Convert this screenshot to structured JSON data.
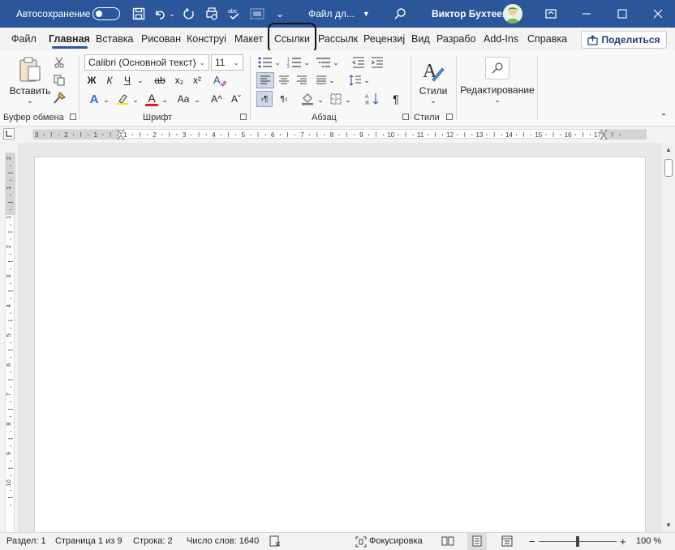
{
  "titlebar": {
    "autosave_label": "Автосохранение",
    "file_name": "Файл дл...",
    "user_name": "Виктор Бухтеев",
    "colors": {
      "bar": "#2b579a"
    }
  },
  "tabs": [
    {
      "label": "Файл"
    },
    {
      "label": "Главная"
    },
    {
      "label": "Вставка"
    },
    {
      "label": "Рисован"
    },
    {
      "label": "Конструі"
    },
    {
      "label": "Макет"
    },
    {
      "label": "Ссылки"
    },
    {
      "label": "Рассылк"
    },
    {
      "label": "Рецензиј"
    },
    {
      "label": "Вид"
    },
    {
      "label": "Разрабо"
    },
    {
      "label": "Add-Ins"
    },
    {
      "label": "Справка"
    }
  ],
  "share_label": "Поделиться",
  "ribbon": {
    "clipboard": {
      "paste_label": "Вставить",
      "group_label": "Буфер обмена"
    },
    "font": {
      "font_name": "Calibri (Основной текст)",
      "font_size": "11",
      "bold": "Ж",
      "italic": "К",
      "underline": "Ч",
      "strike": "ab",
      "sub": "x₂",
      "sup": "x²",
      "text_effects": "A",
      "highlight": "ab",
      "font_color": "A",
      "change_case": "Aa",
      "grow": "A^",
      "shrink": "Aˇ",
      "group_label": "Шрифт"
    },
    "paragraph": {
      "group_label": "Абзац"
    },
    "styles": {
      "label": "Стили",
      "group_label": "Стили"
    },
    "editing": {
      "label": "Редактирование"
    }
  },
  "ruler": {
    "h_ticks": [
      "3",
      "2",
      "1",
      "1",
      "2",
      "3",
      "4",
      "5",
      "6",
      "7",
      "8",
      "9",
      "10",
      "11",
      "12",
      "13",
      "14",
      "15",
      "16",
      "17"
    ],
    "v_ticks": [
      "2",
      "1",
      "1",
      "2",
      "3",
      "4",
      "5",
      "6",
      "7",
      "8",
      "9",
      "10"
    ]
  },
  "statusbar": {
    "section": "Раздел: 1",
    "page": "Страница 1 из 9",
    "line": "Строка: 2",
    "words": "Число слов: 1640",
    "focus": "Фокусировка",
    "zoom": "100 %",
    "zoom_minus": "−",
    "zoom_plus": "+"
  }
}
